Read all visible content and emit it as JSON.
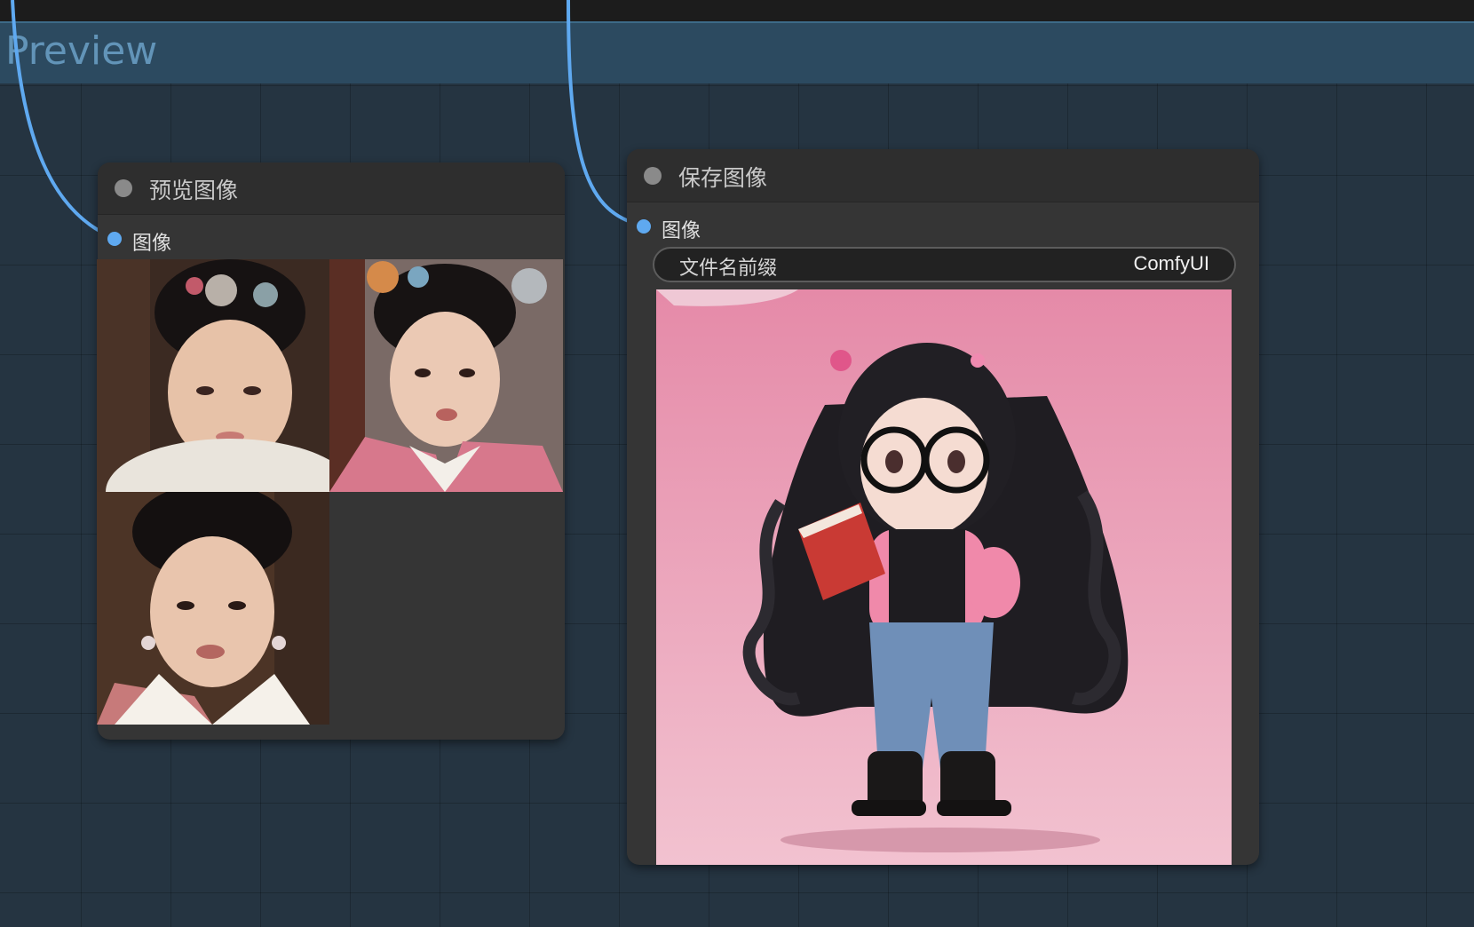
{
  "group": {
    "title": "Preview"
  },
  "preview_node": {
    "title": "预览图像",
    "input_label": "图像",
    "images": [
      "portrait-1",
      "portrait-2",
      "portrait-3"
    ]
  },
  "save_node": {
    "title": "保存图像",
    "input_label": "图像",
    "widget": {
      "label": "文件名前缀",
      "value": "ComfyUI"
    },
    "image": "chibi-figurine"
  },
  "colors": {
    "canvas": "#253441",
    "group": "#2c4a60",
    "node_body": "#353535",
    "node_header": "#2e2e2e",
    "link": "#5fa9f0"
  }
}
